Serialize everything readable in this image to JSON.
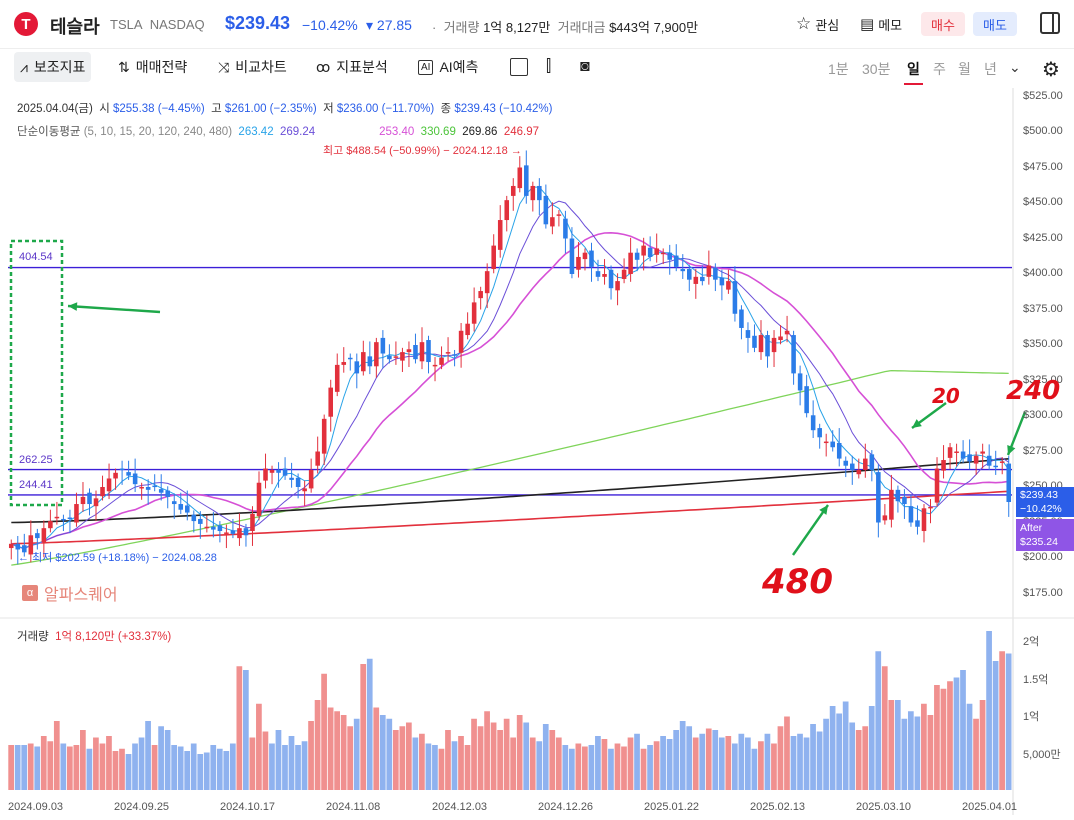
{
  "header": {
    "logo_letter": "T",
    "name": "테슬라",
    "symbol": "TSLA",
    "exchange": "NASDAQ",
    "price": "$239.43",
    "change_pct": "−10.42%",
    "change_abs": "27.85",
    "volume_label": "거래량",
    "volume": "1억 8,127만",
    "amount_label": "거래대금",
    "amount": "$443억 7,900만",
    "watch_label": "관심",
    "memo_label": "메모",
    "buy_label": "매수",
    "sell_label": "매도"
  },
  "toolbar": {
    "indicators": "보조지표",
    "strategy": "매매전략",
    "compare": "비교차트",
    "analysis": "지표분석",
    "ai": "AI예측",
    "periods": [
      "1분",
      "30분",
      "일",
      "주",
      "월",
      "년"
    ],
    "selected_period": "일"
  },
  "info": {
    "date": "2025.04.04(금)",
    "open_label": "시",
    "open": "$255.38 (−4.45%)",
    "high_label": "고",
    "high": "$261.00 (−2.35%)",
    "low_label": "저",
    "low": "$236.00 (−11.70%)",
    "close_label": "종",
    "close": "$239.43 (−10.42%)",
    "ma_label": "단순이동평균",
    "ma_periods": "(5, 10, 15, 20, 120, 240, 480)",
    "ma_values": [
      "263.42",
      "269.24",
      "253.40",
      "330.69",
      "269.86",
      "246.97"
    ],
    "ma_colors": [
      "#29a3e8",
      "#6b4fd8",
      "#d650d6",
      "#4cc43a",
      "#222222",
      "#e2303c"
    ]
  },
  "chart_data": {
    "type": "candlestick",
    "x_ticks": [
      "2024.09.03",
      "2024.09.25",
      "2024.10.17",
      "2024.11.08",
      "2024.12.03",
      "2024.12.26",
      "2025.01.22",
      "2025.02.13",
      "2025.03.10",
      "2025.04.01"
    ],
    "y_ticks": [
      "$525.00",
      "$500.00",
      "$475.00",
      "$450.00",
      "$425.00",
      "$400.00",
      "$375.00",
      "$350.00",
      "$325.00",
      "$300.00",
      "$275.00",
      "$250.00",
      "$225.00",
      "$200.00",
      "$175.00"
    ],
    "ylim": [
      175,
      525
    ],
    "close": [
      210,
      206,
      204,
      216,
      214,
      221,
      226,
      229,
      227,
      228,
      238,
      243,
      238,
      242,
      250,
      256,
      260,
      262,
      258,
      252,
      250,
      248,
      250,
      246,
      243,
      238,
      234,
      232,
      226,
      224,
      222,
      220,
      219,
      218,
      217,
      221,
      216,
      231,
      253,
      263,
      262,
      260,
      258,
      255,
      250,
      249,
      262,
      275,
      298,
      320,
      336,
      338,
      340,
      330,
      345,
      335,
      352,
      344,
      340,
      342,
      345,
      347,
      340,
      352,
      338,
      336,
      341,
      345,
      343,
      360,
      365,
      380,
      388,
      402,
      420,
      438,
      452,
      462,
      475,
      455,
      462,
      452,
      435,
      440,
      442,
      425,
      400,
      412,
      415,
      405,
      398,
      400,
      390,
      395,
      403,
      415,
      410,
      420,
      412,
      418,
      415,
      410,
      405,
      402,
      396,
      398,
      395,
      406,
      396,
      392,
      395,
      372,
      362,
      355,
      348,
      357,
      342,
      355,
      356,
      360,
      330,
      318,
      302,
      290,
      285,
      282,
      278,
      270,
      265,
      262,
      262,
      270,
      262,
      225,
      230,
      248,
      240,
      238,
      225,
      222,
      235,
      236,
      263,
      269,
      278,
      275,
      270,
      268,
      272,
      275,
      265,
      264,
      268,
      239.43
    ],
    "high": 488.54,
    "high_note": "최고 $488.54 (−50.99%) − 2024.12.18",
    "low": 202.59,
    "low_note": "최저 $202.59 (+18.18%) − 2024.08.28",
    "horizontal_levels": [
      "404.54",
      "262.25",
      "244.41"
    ],
    "ma_series": [
      {
        "period": 5,
        "color": "#29a3e8",
        "last": 263.42
      },
      {
        "period": 10,
        "color": "#6b4fd8",
        "last": 269.24
      },
      {
        "period": 20,
        "color": "#d650d6",
        "last": 253.4
      },
      {
        "period": 120,
        "color": "#4cc43a",
        "last": 330.69
      },
      {
        "period": 240,
        "color": "#222222",
        "last": 269.86
      },
      {
        "period": 480,
        "color": "#e2303c",
        "last": 246.97
      }
    ],
    "price_tag": "$239.43",
    "price_tag_pct": "−10.42%",
    "after_label": "After",
    "after_price": "$235.24"
  },
  "volume_chart": {
    "label": "거래량",
    "value": "1억 8,120만 (+33.37%)",
    "y_ticks": [
      "2억",
      "1.5억",
      "1억",
      "5,000만"
    ],
    "values_million": [
      60,
      60,
      60,
      62,
      58,
      72,
      65,
      92,
      62,
      58,
      60,
      80,
      55,
      70,
      62,
      72,
      52,
      55,
      48,
      62,
      70,
      92,
      60,
      85,
      80,
      60,
      58,
      52,
      62,
      48,
      50,
      60,
      55,
      52,
      62,
      165,
      160,
      70,
      115,
      78,
      62,
      80,
      60,
      72,
      60,
      65,
      92,
      120,
      155,
      110,
      105,
      100,
      85,
      95,
      168,
      175,
      110,
      100,
      95,
      80,
      85,
      90,
      70,
      75,
      62,
      60,
      55,
      80,
      65,
      72,
      60,
      95,
      85,
      105,
      90,
      80,
      95,
      70,
      100,
      90,
      70,
      65,
      88,
      80,
      70,
      60,
      55,
      62,
      58,
      60,
      72,
      68,
      55,
      62,
      58,
      70,
      75,
      55,
      60,
      65,
      72,
      68,
      80,
      92,
      85,
      70,
      75,
      82,
      80,
      70,
      72,
      62,
      75,
      70,
      55,
      65,
      75,
      62,
      85,
      98,
      72,
      75,
      70,
      88,
      78,
      95,
      112,
      102,
      118,
      90,
      80,
      85,
      112,
      185,
      165,
      120,
      120,
      95,
      105,
      98,
      115,
      100,
      140,
      135,
      145,
      150,
      160,
      115,
      95,
      120,
      212,
      172,
      185,
      182
    ],
    "colors_note": "red up / blue down"
  },
  "annotations": {
    "ma20_label": "20",
    "ma240_label": "240",
    "ma480_label": "480"
  },
  "watermark": "알파스퀘어"
}
